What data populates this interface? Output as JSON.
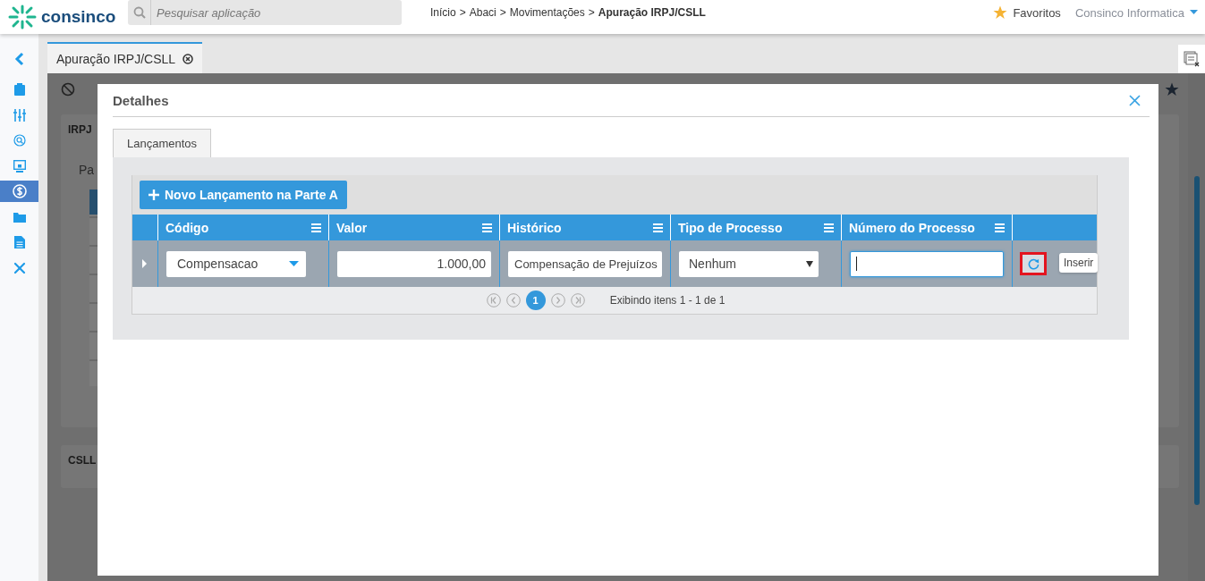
{
  "header": {
    "logo": "consinco",
    "search": {
      "placeholder": "Pesquisar aplicação"
    },
    "breadcrumb": {
      "separator": ">",
      "items": [
        "Início",
        "Abaci",
        "Movimentações",
        "Apuração IRPJ/CSLL"
      ]
    },
    "favorites": "Favoritos",
    "user": "Consinco Informatica"
  },
  "sidebar": {
    "items": [
      {
        "selected": false
      },
      {
        "selected": false
      },
      {
        "selected": false
      },
      {
        "selected": false
      },
      {
        "selected": true
      },
      {
        "selected": false
      },
      {
        "selected": false
      },
      {
        "selected": false
      }
    ]
  },
  "tabs": [
    {
      "label": "Apuração IRPJ/CSLL",
      "selected": true
    }
  ],
  "background": {
    "panels": [
      {
        "title": "IRPJ",
        "subtitle": "Pa"
      },
      {
        "title": "CSLL"
      }
    ]
  },
  "modal": {
    "title": "Detalhes",
    "tabs": [
      {
        "label": "Lançamentos",
        "selected": true
      }
    ],
    "add_button": "Novo Lançamento na Parte A",
    "table": {
      "columns": [
        "Código",
        "Valor",
        "Histórico",
        "Tipo de Processo",
        "Número do Processo"
      ],
      "rows": [
        {
          "expanded": false,
          "cells": [
            {
              "kind": "combo",
              "value": "Compensacao"
            },
            {
              "kind": "number",
              "value": "1.000,00"
            },
            {
              "kind": "text",
              "value": "Compensação de Prejuízos"
            },
            {
              "kind": "select",
              "value": "Nenhum"
            },
            {
              "kind": "input",
              "focused": true
            }
          ],
          "action": {
            "highlighted": true,
            "tooltip": "Inserir"
          }
        }
      ]
    },
    "pager": {
      "pages": [
        {
          "label": "1",
          "selected": true
        }
      ],
      "info": "Exibindo itens 1 - 1 de 1"
    }
  }
}
